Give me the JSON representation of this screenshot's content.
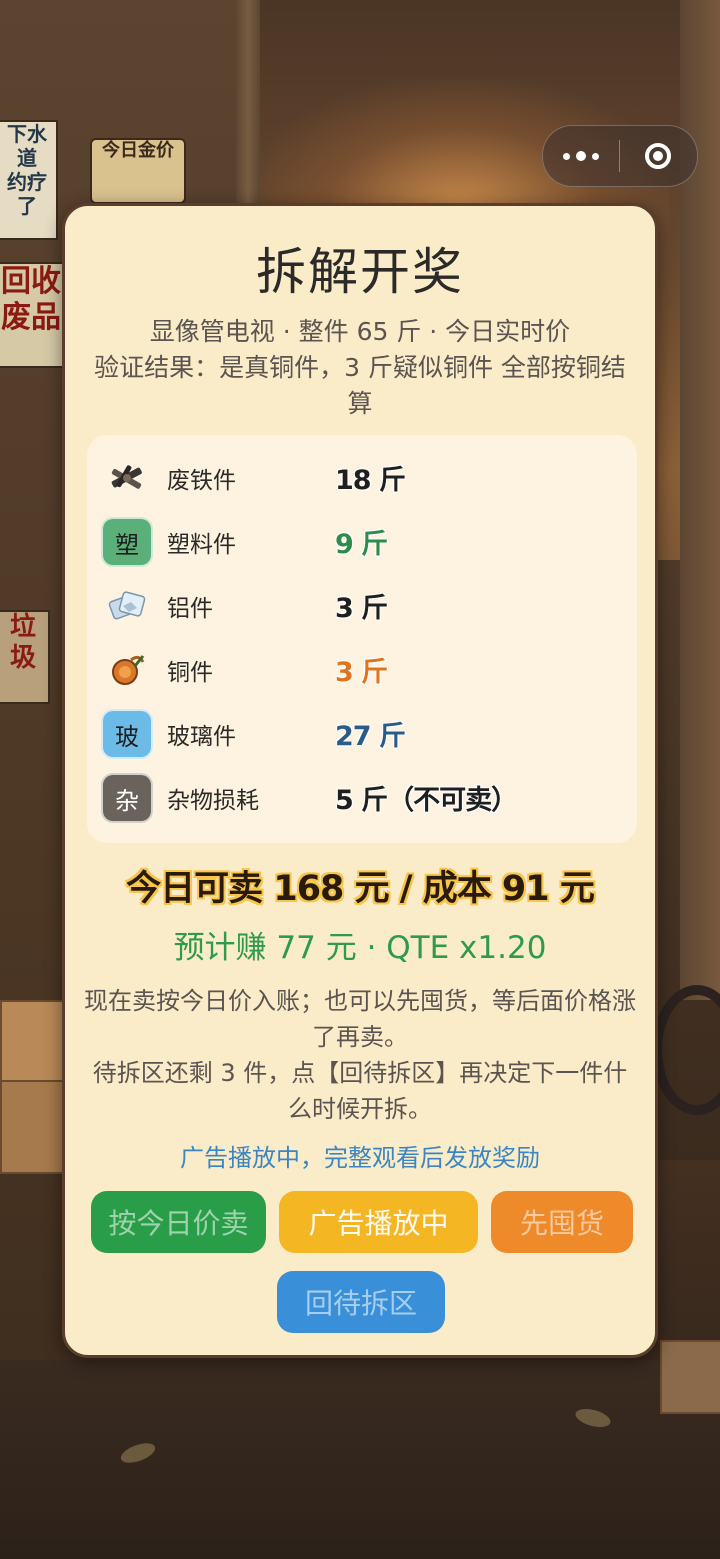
{
  "capsule": {
    "more_icon": "more-dots-icon",
    "close_icon": "close-circle-icon"
  },
  "background": {
    "sign_a": "下水道\n约疗了",
    "sign_b": "今日金价",
    "sign_c": "回收\n废品",
    "sign_d": "垃圾"
  },
  "modal": {
    "title": "拆解开奖",
    "subtitle_line1": "显像管电视 · 整件 65 斤 · 今日实时价",
    "subtitle_line2": "验证结果：是真铜件，3 斤疑似铜件 全部按铜结算",
    "items": [
      {
        "name": "废铁件",
        "amount": "18 斤",
        "color": "#1f1f1f",
        "icon": "scrap-iron-icon"
      },
      {
        "name": "塑料件",
        "amount": "9 斤",
        "color": "#2e8b4a",
        "icon": "plastic-badge-icon",
        "badge": "塑",
        "badge_color": "#5bb07a"
      },
      {
        "name": "铝件",
        "amount": "3 斤",
        "color": "#1f1f1f",
        "icon": "aluminum-icon"
      },
      {
        "name": "铜件",
        "amount": "3 斤",
        "color": "#e0741e",
        "icon": "copper-icon"
      },
      {
        "name": "玻璃件",
        "amount": "27 斤",
        "color": "#2a5c8a",
        "icon": "glass-badge-icon",
        "badge": "玻",
        "badge_color": "#6bbbe6"
      },
      {
        "name": "杂物损耗",
        "amount": "5 斤（不可卖）",
        "color": "#1f1f1f",
        "icon": "misc-badge-icon",
        "badge": "杂",
        "badge_color": "#6b625b"
      }
    ],
    "summary": "今日可卖 168 元 / 成本 91 元",
    "profit": "预计赚 77 元 · QTE x1.20",
    "desc_line1": "现在卖按今日价入账；也可以先囤货，等后面价格涨了再卖。",
    "desc_line2": "待拆区还剩 3 件，点【回待拆区】再决定下一件什么时候开拆。",
    "ad_tip": "广告播放中，完整观看后发放奖励",
    "buttons": {
      "sell": "按今日价卖",
      "ad": "广告播放中",
      "hoard": "先囤货",
      "back": "回待拆区"
    }
  }
}
